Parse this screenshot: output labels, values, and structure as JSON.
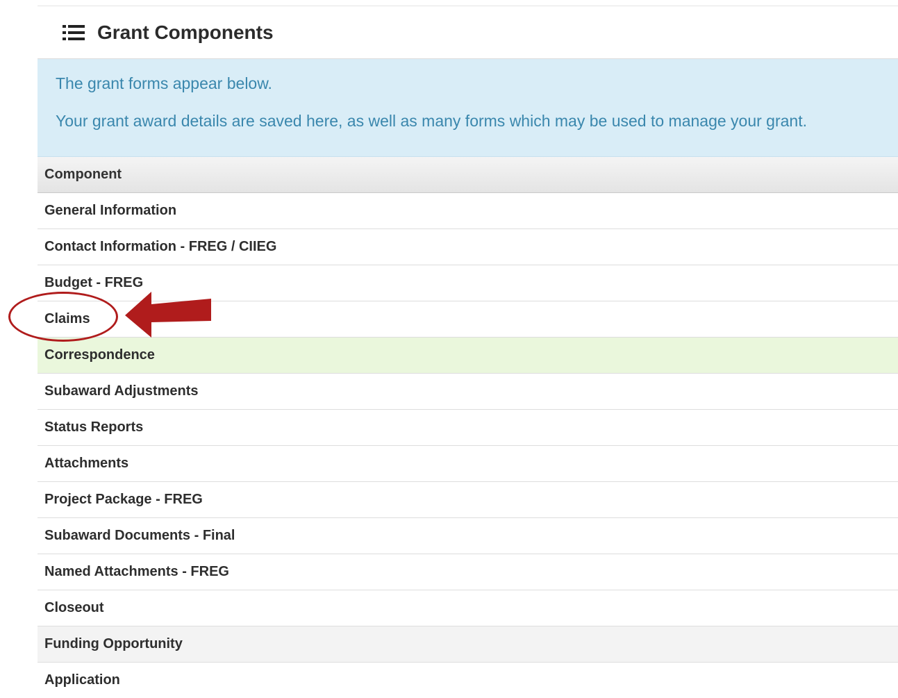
{
  "header": {
    "icon": "list-icon",
    "title": "Grant Components"
  },
  "info": {
    "line1": "The grant forms appear below.",
    "line2": "Your grant award details are saved here, as well as many forms which may be used to manage your grant."
  },
  "table": {
    "column_header": "Component",
    "rows": [
      {
        "label": "General Information"
      },
      {
        "label": "Contact Information - FREG / CIIEG"
      },
      {
        "label": "Budget - FREG"
      },
      {
        "label": "Claims"
      },
      {
        "label": "Correspondence"
      },
      {
        "label": "Subaward Adjustments"
      },
      {
        "label": "Status Reports"
      },
      {
        "label": "Attachments"
      },
      {
        "label": "Project Package - FREG"
      },
      {
        "label": "Subaward Documents - Final"
      },
      {
        "label": "Named Attachments - FREG"
      },
      {
        "label": "Closeout"
      },
      {
        "label": "Funding Opportunity"
      },
      {
        "label": "Application"
      }
    ]
  },
  "colors": {
    "info_background": "#d9edf7",
    "info_text": "#3a87ad",
    "highlight_row": "#eaf7dc",
    "annotation_red": "#b01c1c"
  },
  "annotation": {
    "target": "Claims",
    "shapes": [
      "circle",
      "arrow-left-icon"
    ]
  }
}
